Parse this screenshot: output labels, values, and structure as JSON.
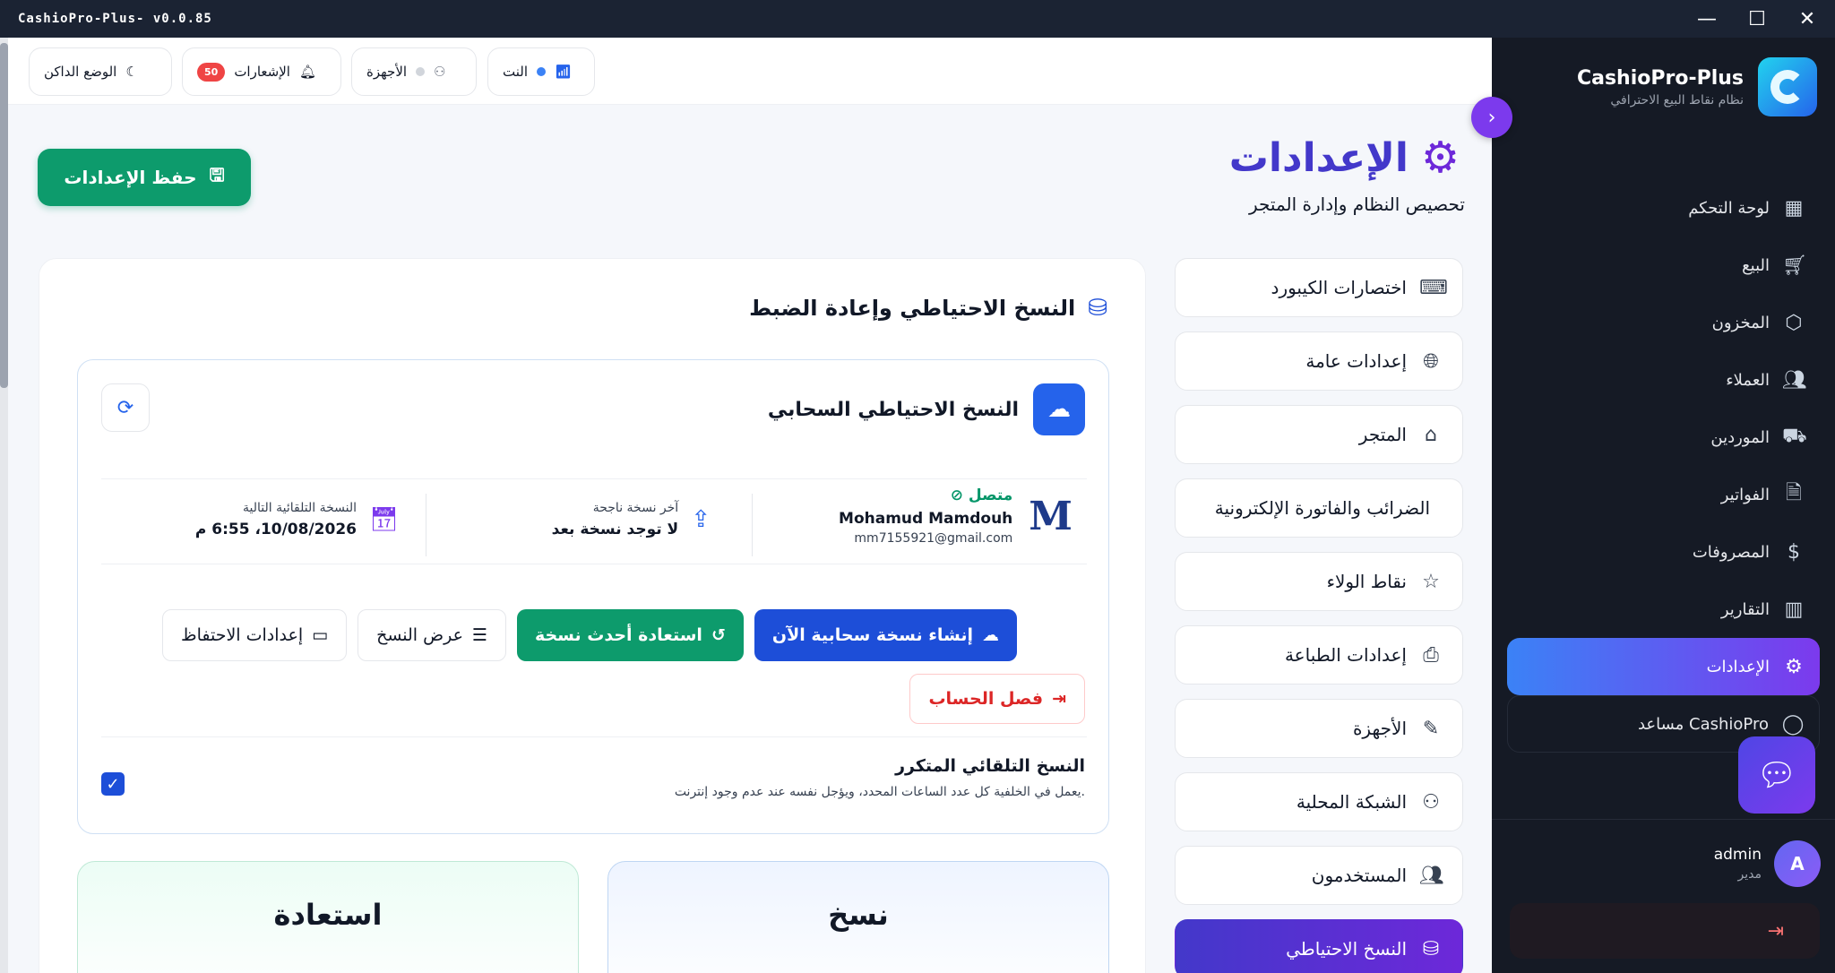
{
  "window": {
    "title": "CashioPro-Plus- v0.0.85",
    "minimize": "—",
    "maximize": "☐",
    "close": "✕"
  },
  "brand": {
    "name": "CashioPro-Plus",
    "subtitle": "نظام نقاط البيع الاحترافي"
  },
  "sidebar": {
    "items": [
      {
        "label": "لوحة التحكم",
        "icon": "▦",
        "icon_name": "dashboard-icon"
      },
      {
        "label": "البيع",
        "icon": "🛒︎",
        "icon_name": "cart-icon"
      },
      {
        "label": "المخزون",
        "icon": "⬡",
        "icon_name": "box-icon"
      },
      {
        "label": "العملاء",
        "icon": "👥︎",
        "icon_name": "customers-icon"
      },
      {
        "label": "الموردين",
        "icon": "⛟",
        "icon_name": "truck-icon"
      },
      {
        "label": "الفواتير",
        "icon": "🗎",
        "icon_name": "invoice-icon"
      },
      {
        "label": "المصروفات",
        "icon": "$",
        "icon_name": "expenses-icon"
      },
      {
        "label": "التقارير",
        "icon": "▥",
        "icon_name": "reports-icon"
      },
      {
        "label": "الإعدادات",
        "icon": "⚙",
        "icon_name": "settings-icon"
      },
      {
        "label": "مساعد CashioPro",
        "icon": "◯",
        "icon_name": "assistant-icon"
      }
    ]
  },
  "user": {
    "initial": "A",
    "name": "admin",
    "role": "مدير"
  },
  "topbar": {
    "dark_mode": "الوضع الداكن",
    "notifications": "الإشعارات",
    "notif_count": "50",
    "devices": "الأجهزة",
    "internet": "النت"
  },
  "page": {
    "title": "الإعدادات",
    "subtitle": "تحصيص النظام وإدارة المتجر",
    "save": "حفظ الإعدادات"
  },
  "settings_nav": {
    "items": [
      {
        "label": "اختصارات الكيبورد",
        "icon": "⌨",
        "icon_name": "keyboard-icon"
      },
      {
        "label": "إعدادات عامة",
        "icon": "🌐︎",
        "icon_name": "globe-icon"
      },
      {
        "label": "المتجر",
        "icon": "⌂",
        "icon_name": "store-icon"
      },
      {
        "label": "الضرائب والفاتورة الإلكترونية",
        "icon": "",
        "icon_name": ""
      },
      {
        "label": "نقاط الولاء",
        "icon": "☆",
        "icon_name": "star-icon"
      },
      {
        "label": "إعدادات الطباعة",
        "icon": "⎙",
        "icon_name": "printer-icon"
      },
      {
        "label": "الأجهزة",
        "icon": "✎",
        "icon_name": "devices-icon"
      },
      {
        "label": "الشبكة المحلية",
        "icon": "⚇",
        "icon_name": "network-icon"
      },
      {
        "label": "المستخدمون",
        "icon": "👥︎",
        "icon_name": "users-icon"
      },
      {
        "label": "النسخ الاحتياطي",
        "icon": "⛁",
        "icon_name": "database-icon"
      }
    ]
  },
  "backup": {
    "section_title": "النسخ الاحتياطي وإعادة الضبط",
    "cloud_title": "النسخ الاحتياطي السحابي",
    "status": "متصل",
    "account_name": "Mohamud Mamdouh",
    "account_email": "mm7155921@gmail.com",
    "last_label": "آخر نسخة ناجحة",
    "last_value": "لا توجد نسخة بعد",
    "next_label": "النسخة التلقائية التالية",
    "next_value": "10/08/2026، 6:55 م",
    "btn_create": "إنشاء نسخة سحابية الآن",
    "btn_restore": "استعادة أحدث نسخة",
    "btn_view": "عرض النسخ",
    "btn_retention": "إعدادات الاحتفاظ",
    "btn_disconnect": "فصل الحساب",
    "auto_title": "النسخ التلقائي المتكرر",
    "auto_desc": "يعمل في الخلفية كل عدد الساعات المحدد، ويؤجل نفسه عند عدم وجود إنترنت.",
    "auto_enabled": true,
    "card_backup": "نسخ",
    "card_restore": "استعادة"
  },
  "colors": {
    "primary": "#1d4ed8",
    "success": "#0d9b6c",
    "danger": "#dc2626",
    "sidebar_bg": "#151a25",
    "accent_gradient_from": "#3b82f6",
    "accent_gradient_to": "#7c3aed"
  }
}
